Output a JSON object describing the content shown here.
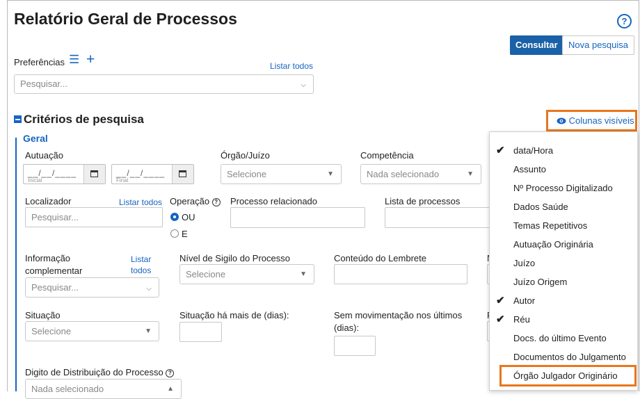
{
  "header": {
    "title": "Relatório Geral de Processos",
    "help_icon": "?",
    "consultar_label": "Consultar",
    "nova_pesquisa_label": "Nova pesquisa"
  },
  "preferencias": {
    "label": "Preferências",
    "list_icon": "☰",
    "add_icon": "+",
    "listar_todos": "Listar todos",
    "search_placeholder": "Pesquisar..."
  },
  "criterios": {
    "title": "Critérios de pesquisa",
    "colunas_visiveis": "Colunas visíveis",
    "group_label": "Geral"
  },
  "fields": {
    "autuacao": {
      "label": "Autuação",
      "date_mask": "__/__/____",
      "initial_label": "Inicial",
      "final_label": "Final"
    },
    "orgao_juizo": {
      "label": "Órgão/Juízo",
      "placeholder": "Selecione"
    },
    "competencia": {
      "label": "Competência",
      "placeholder": "Nada selecionado"
    },
    "localizador": {
      "label": "Localizador",
      "listar_todos": "Listar todos",
      "placeholder": "Pesquisar..."
    },
    "operacao": {
      "label": "Operação",
      "options": [
        "OU",
        "E"
      ],
      "selected": "OU"
    },
    "processo_relacionado": {
      "label": "Processo relacionado"
    },
    "lista_processos": {
      "label": "Lista de processos"
    },
    "informacao_complementar": {
      "label_line1": "Informação",
      "label_line2": "complementar",
      "listar_line1": "Listar",
      "listar_line2": "todos",
      "placeholder": "Pesquisar..."
    },
    "nivel_sigilo": {
      "label": "Nível de Sigilo do Processo",
      "placeholder": "Selecione"
    },
    "conteudo_lembrete": {
      "label": "Conteúdo do Lembrete"
    },
    "clipped_label_n": "N",
    "situacao": {
      "label": "Situação",
      "placeholder": "Selecione"
    },
    "situacao_dias": {
      "label": "Situação há mais de (dias):"
    },
    "sem_movimentacao": {
      "label_line1": "Sem movimentação nos últimos",
      "label_line2": "(dias):"
    },
    "clipped_label_p": "F",
    "digito_distribuicao": {
      "label": "Digito de Distribuição do Processo",
      "placeholder": "Nada selecionado"
    }
  },
  "colunas_menu": [
    {
      "label": "data/Hora",
      "checked": true
    },
    {
      "label": "Assunto",
      "checked": false
    },
    {
      "label": "Nº Processo Digitalizado",
      "checked": false
    },
    {
      "label": "Dados Saúde",
      "checked": false
    },
    {
      "label": "Temas Repetitivos",
      "checked": false
    },
    {
      "label": "Autuação Originária",
      "checked": false
    },
    {
      "label": "Juízo",
      "checked": false
    },
    {
      "label": "Juízo Origem",
      "checked": false
    },
    {
      "label": "Autor",
      "checked": true
    },
    {
      "label": "Réu",
      "checked": true
    },
    {
      "label": "Docs. do último Evento",
      "checked": false
    },
    {
      "label": "Documentos do Julgamento",
      "checked": false
    },
    {
      "label": "Órgão Julgador Originário",
      "checked": false
    }
  ],
  "colors": {
    "accent": "#1565c0",
    "primary_button": "#1a61a8",
    "highlight": "#e8761c"
  }
}
